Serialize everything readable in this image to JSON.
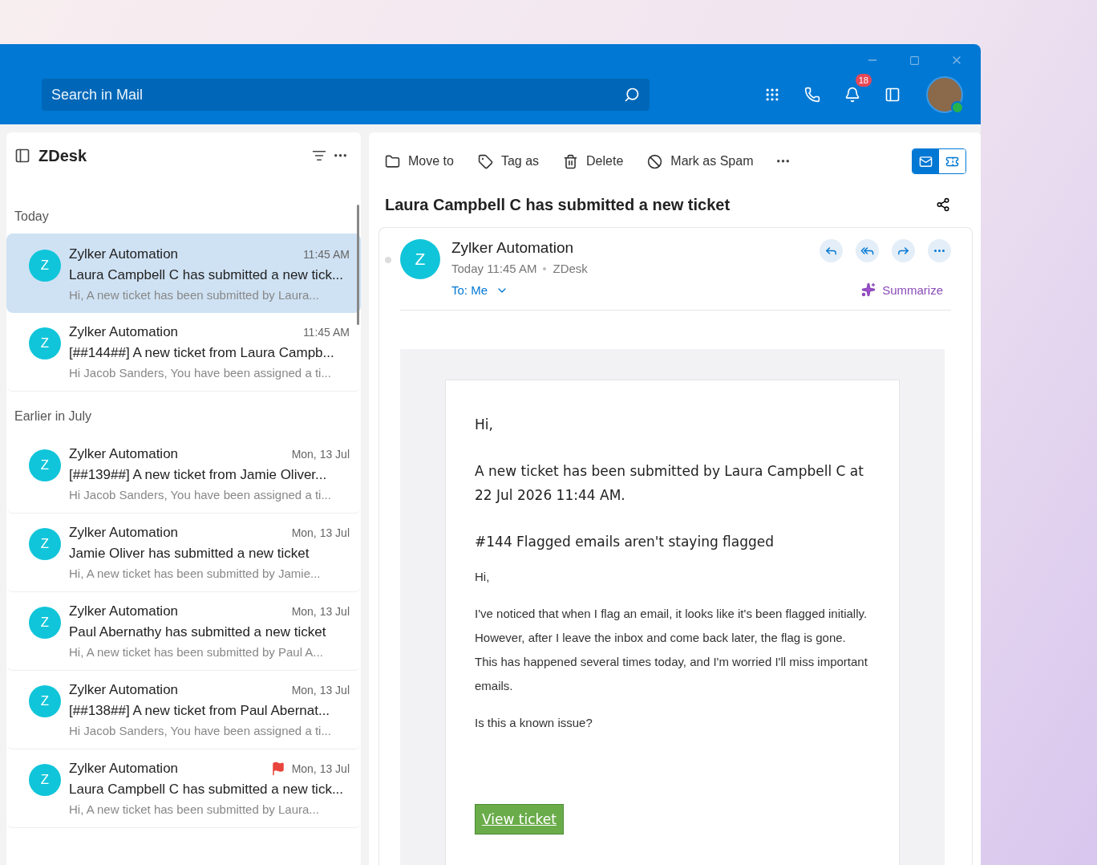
{
  "header": {
    "search": {
      "placeholder": "Search in Mail"
    },
    "notifications": {
      "count": "18"
    },
    "user": {
      "online": true
    }
  },
  "sidebar": {
    "title": "ZDesk",
    "groups": [
      {
        "label": "Today",
        "messages": [
          {
            "initial": "Z",
            "sender": "Zylker Automation",
            "time": "11:45 AM",
            "subject": "Laura Campbell C has submitted a new tick...",
            "preview": "Hi, A new ticket has been submitted by Laura...",
            "selected": true,
            "flagged": false
          },
          {
            "initial": "Z",
            "sender": "Zylker Automation",
            "time": "11:45 AM",
            "subject": "[##144##] A new ticket from Laura Campb...",
            "preview": "Hi Jacob Sanders, You have been assigned a ti...",
            "selected": false,
            "flagged": false
          }
        ]
      },
      {
        "label": "Earlier in July",
        "messages": [
          {
            "initial": "Z",
            "sender": "Zylker Automation",
            "time": "Mon, 13 Jul",
            "subject": "[##139##] A new ticket from Jamie Oliver...",
            "preview": "Hi Jacob Sanders, You have been assigned a ti...",
            "selected": false,
            "flagged": false
          },
          {
            "initial": "Z",
            "sender": "Zylker Automation",
            "time": "Mon, 13 Jul",
            "subject": "Jamie Oliver has submitted a new ticket",
            "preview": "Hi, A new ticket has been submitted by Jamie...",
            "selected": false,
            "flagged": false
          },
          {
            "initial": "Z",
            "sender": "Zylker Automation",
            "time": "Mon, 13 Jul",
            "subject": "Paul Abernathy has submitted a new ticket",
            "preview": "Hi, A new ticket has been submitted by Paul A...",
            "selected": false,
            "flagged": false
          },
          {
            "initial": "Z",
            "sender": "Zylker Automation",
            "time": "Mon, 13 Jul",
            "subject": "[##138##] A new ticket from Paul Abernat...",
            "preview": "Hi Jacob Sanders, You have been assigned a ti...",
            "selected": false,
            "flagged": false
          },
          {
            "initial": "Z",
            "sender": "Zylker Automation",
            "time": "Mon, 13 Jul",
            "subject": "Laura Campbell C has submitted a new tick...",
            "preview": "Hi, A new ticket has been submitted by Laura...",
            "selected": false,
            "flagged": true
          }
        ]
      }
    ]
  },
  "toolbar": {
    "actions": [
      {
        "kind": "move",
        "label": "Move to"
      },
      {
        "kind": "tag",
        "label": "Tag as"
      },
      {
        "kind": "delete",
        "label": "Delete"
      },
      {
        "kind": "spam",
        "label": "Mark as Spam"
      }
    ],
    "view_toggle": [
      {
        "kind": "mail",
        "selected": true
      },
      {
        "kind": "ticket",
        "selected": false
      }
    ]
  },
  "reading": {
    "subject": "Laura Campbell C has submitted a new ticket",
    "initial": "Z",
    "sender": "Zylker Automation",
    "date": "Today 11:45 AM",
    "folder": "ZDesk",
    "to": "To: Me",
    "summarize": "Summarize",
    "unread": false,
    "body": {
      "greeting": "Hi,",
      "intro": "A new ticket has been submitted by Laura Campbell C at 22 Jul 2026 11:44 AM.",
      "ticket_title": "#144 Flagged emails aren't staying flagged",
      "paragraphs": [
        "Hi,",
        "I've noticed that when I flag an email, it looks like it's been flagged initially. However, after I leave the inbox and come back later, the flag is gone. This has happened several times today, and I'm worried I'll miss important emails.",
        "Is this a known issue?"
      ],
      "button": "View ticket"
    }
  }
}
